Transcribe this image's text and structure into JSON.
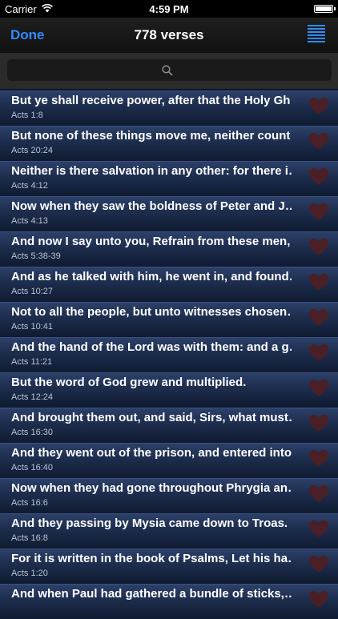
{
  "status": {
    "carrier": "Carrier",
    "time": "4:59 PM"
  },
  "nav": {
    "done_label": "Done",
    "title": "778 verses"
  },
  "search": {
    "placeholder": ""
  },
  "colors": {
    "accent": "#2f8cff",
    "heart": "#4a1f25"
  },
  "verses": [
    {
      "text": "But ye shall receive power, after that the Holy Gh…",
      "ref": "Acts 1:8"
    },
    {
      "text": "But none of these things move me, neither count…",
      "ref": "Acts 20:24"
    },
    {
      "text": "Neither is there salvation in any other: for there i…",
      "ref": "Acts 4:12"
    },
    {
      "text": "Now when they saw the boldness of Peter and J…",
      "ref": "Acts 4:13"
    },
    {
      "text": "And now I say unto you, Refrain from these men,…",
      "ref": "Acts 5:38-39"
    },
    {
      "text": "And as he talked with him, he went in, and found…",
      "ref": "Acts 10:27"
    },
    {
      "text": "Not to all the people, but unto witnesses chosen…",
      "ref": "Acts 10:41"
    },
    {
      "text": "And the hand of the Lord was with them: and a g…",
      "ref": "Acts 11:21"
    },
    {
      "text": "But the word of God grew and multiplied.",
      "ref": "Acts 12:24"
    },
    {
      "text": "And brought them out, and said, Sirs, what must…",
      "ref": "Acts 16:30"
    },
    {
      "text": "And they went out of the prison, and entered into…",
      "ref": "Acts 16:40"
    },
    {
      "text": "Now when they had gone throughout Phrygia an…",
      "ref": "Acts 16:6"
    },
    {
      "text": "And they passing by Mysia came down to Troas.",
      "ref": "Acts 16:8"
    },
    {
      "text": "For it is written in the book of Psalms, Let his ha…",
      "ref": "Acts 1:20"
    },
    {
      "text": "And when Paul had gathered a bundle of sticks,…",
      "ref": ""
    }
  ]
}
